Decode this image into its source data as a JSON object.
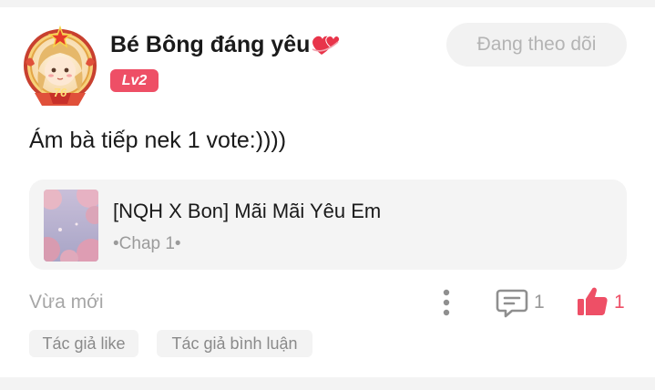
{
  "comment": {
    "author": {
      "name": "Bé Bông đáng yêu",
      "level_badge": "Lv2",
      "avatar_frame_number": "76"
    },
    "follow_button_label": "Đang theo dõi",
    "text": "Ám bà tiếp nek 1 vote:))))",
    "story": {
      "title": "[NQH X Bon] Mãi Mãi Yêu Em",
      "chapter": "•Chap 1•"
    },
    "time": "Vừa mới",
    "reply_count": "1",
    "like_count": "1",
    "tags": [
      {
        "label": "Tác giả like"
      },
      {
        "label": "Tác giả bình luận"
      }
    ]
  },
  "icons": {
    "heart": "two-hearts-icon",
    "more": "more-vertical-icon",
    "comment": "comment-icon",
    "like": "thumbs-up-icon"
  },
  "colors": {
    "accent": "#ee4f66",
    "muted_text": "#a6a6a6",
    "card_bg": "#f4f4f4"
  }
}
